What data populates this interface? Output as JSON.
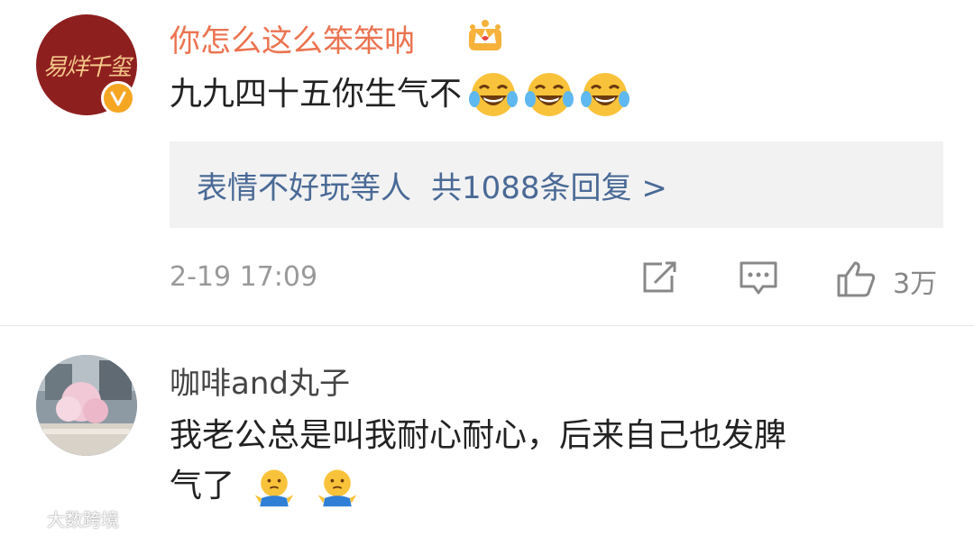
{
  "comments": [
    {
      "username": "你怎么这么笨笨呐",
      "avatar_text": "易烊千玺",
      "text": "九九四十五你生气不",
      "emojis": [
        "laughing-tears-emoji",
        "laughing-tears-emoji",
        "laughing-tears-emoji"
      ],
      "reply_summary": {
        "author": "表情不好玩等人",
        "count_label": "共1088条回复 >"
      },
      "timestamp": "2-19 17:09",
      "like_count": "3万"
    },
    {
      "username": "咖啡and丸子",
      "text_line1": "我老公总是叫我耐心耐心，后来自己也发脾",
      "text_line2": "气了",
      "emojis": [
        "shrug-emoji",
        "shrug-emoji"
      ]
    }
  ],
  "watermark": "大数跨境",
  "colors": {
    "username_highlight": "#eb7350",
    "link": "#4a6a96",
    "meta": "#999999",
    "verified": "#f5a623"
  }
}
